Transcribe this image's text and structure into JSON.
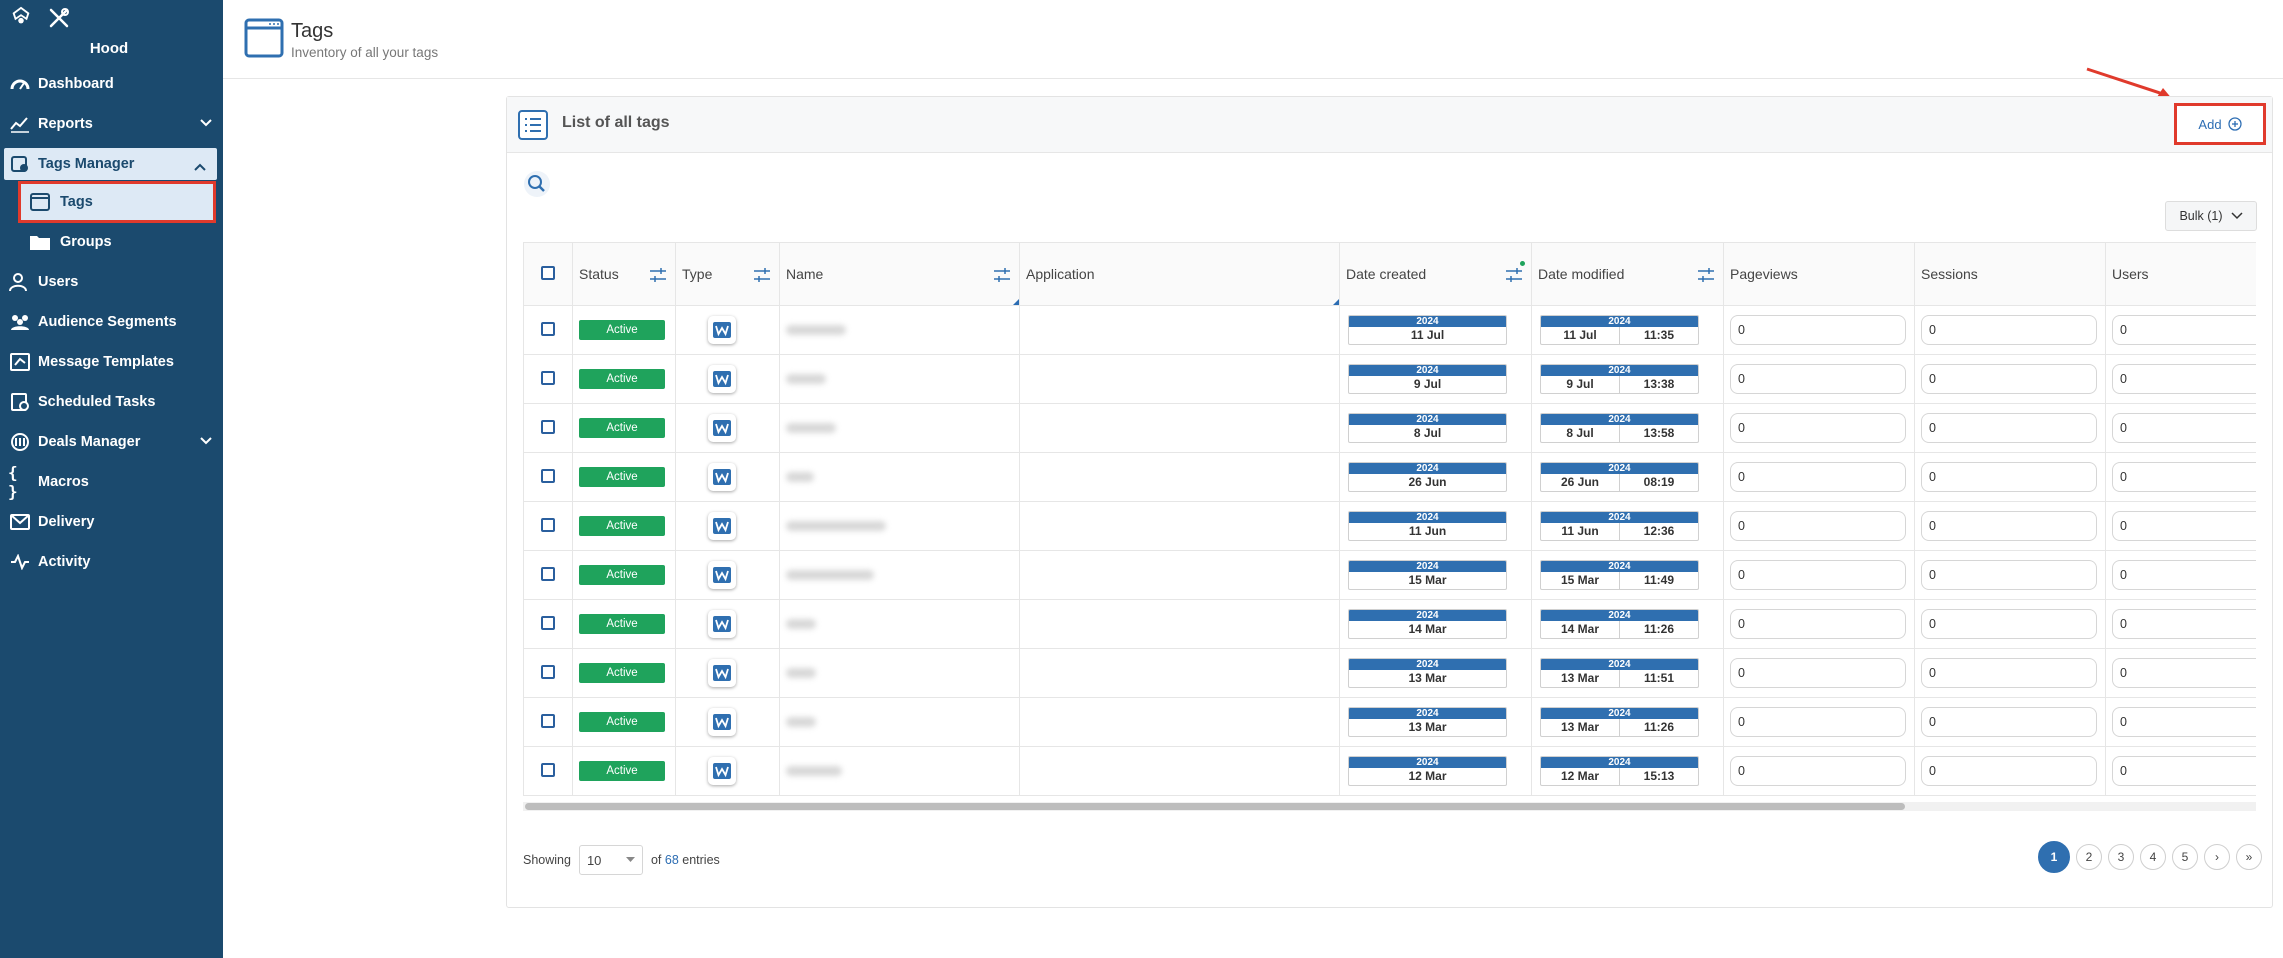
{
  "sidebar": {
    "brand": "Hood",
    "items": [
      {
        "label": "Dashboard",
        "icon": "dashboard-icon"
      },
      {
        "label": "Reports",
        "icon": "reports-icon"
      },
      {
        "label": "Tags Manager",
        "icon": "tags-manager-icon"
      },
      {
        "label": "Tags",
        "icon": "window-icon"
      },
      {
        "label": "Groups",
        "icon": "folder-icon"
      },
      {
        "label": "Users",
        "icon": "users-icon"
      },
      {
        "label": "Audience Segments",
        "icon": "audience-icon"
      },
      {
        "label": "Message Templates",
        "icon": "message-icon"
      },
      {
        "label": "Scheduled Tasks",
        "icon": "scheduled-icon"
      },
      {
        "label": "Deals Manager",
        "icon": "deals-icon"
      },
      {
        "label": "Macros",
        "icon": "braces-icon"
      },
      {
        "label": "Delivery",
        "icon": "delivery-icon"
      },
      {
        "label": "Activity",
        "icon": "activity-icon"
      }
    ]
  },
  "header": {
    "title": "Tags",
    "subtitle": "Inventory of all your tags"
  },
  "card": {
    "title": "List of all tags",
    "add_label": "Add",
    "bulk_label": "Bulk (1)"
  },
  "table": {
    "columns": [
      "Status",
      "Type",
      "Name",
      "Application",
      "Date created",
      "Date modified",
      "Pageviews",
      "Sessions",
      "Users"
    ],
    "rows": [
      {
        "status": "Active",
        "created_year": "2024",
        "created_day": "11 Jul",
        "modified_year": "2024",
        "modified_day": "11 Jul",
        "modified_time": "11:35",
        "pageviews": "0",
        "sessions": "0",
        "users": "0"
      },
      {
        "status": "Active",
        "created_year": "2024",
        "created_day": "9 Jul",
        "modified_year": "2024",
        "modified_day": "9 Jul",
        "modified_time": "13:38",
        "pageviews": "0",
        "sessions": "0",
        "users": "0"
      },
      {
        "status": "Active",
        "created_year": "2024",
        "created_day": "8 Jul",
        "modified_year": "2024",
        "modified_day": "8 Jul",
        "modified_time": "13:58",
        "pageviews": "0",
        "sessions": "0",
        "users": "0"
      },
      {
        "status": "Active",
        "created_year": "2024",
        "created_day": "26 Jun",
        "modified_year": "2024",
        "modified_day": "26 Jun",
        "modified_time": "08:19",
        "pageviews": "0",
        "sessions": "0",
        "users": "0"
      },
      {
        "status": "Active",
        "created_year": "2024",
        "created_day": "11 Jun",
        "modified_year": "2024",
        "modified_day": "11 Jun",
        "modified_time": "12:36",
        "pageviews": "0",
        "sessions": "0",
        "users": "0"
      },
      {
        "status": "Active",
        "created_year": "2024",
        "created_day": "15 Mar",
        "modified_year": "2024",
        "modified_day": "15 Mar",
        "modified_time": "11:49",
        "pageviews": "0",
        "sessions": "0",
        "users": "0"
      },
      {
        "status": "Active",
        "created_year": "2024",
        "created_day": "14 Mar",
        "modified_year": "2024",
        "modified_day": "14 Mar",
        "modified_time": "11:26",
        "pageviews": "0",
        "sessions": "0",
        "users": "0"
      },
      {
        "status": "Active",
        "created_year": "2024",
        "created_day": "13 Mar",
        "modified_year": "2024",
        "modified_day": "13 Mar",
        "modified_time": "11:51",
        "pageviews": "0",
        "sessions": "0",
        "users": "0"
      },
      {
        "status": "Active",
        "created_year": "2024",
        "created_day": "13 Mar",
        "modified_year": "2024",
        "modified_day": "13 Mar",
        "modified_time": "11:26",
        "pageviews": "0",
        "sessions": "0",
        "users": "0"
      },
      {
        "status": "Active",
        "created_year": "2024",
        "created_day": "12 Mar",
        "modified_year": "2024",
        "modified_day": "12 Mar",
        "modified_time": "15:13",
        "pageviews": "0",
        "sessions": "0",
        "users": "0"
      }
    ]
  },
  "footer": {
    "showing_label": "Showing",
    "page_length": "10",
    "of_label": "of",
    "total": "68",
    "entries_label": "entries"
  },
  "pagination": {
    "pages": [
      "1",
      "2",
      "3",
      "4",
      "5"
    ],
    "current": "1",
    "next_symbol": "›",
    "last_symbol": "»"
  },
  "colors": {
    "sidebar": "#1b4a6e",
    "accent": "#2f6fb0",
    "active_status": "#1fa35c",
    "highlight": "#e03a2c"
  }
}
